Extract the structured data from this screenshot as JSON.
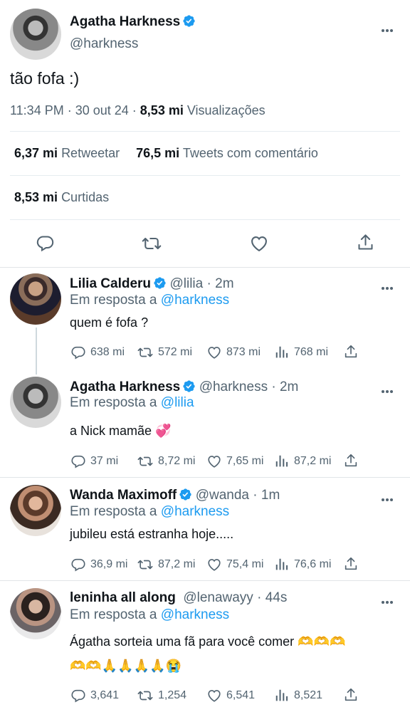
{
  "main_tweet": {
    "name": "Agatha Harkness",
    "handle": "@harkness",
    "text": "tão fofa :)",
    "time": "11:34 PM",
    "date": "30 out 24",
    "views_count": "8,53 mi",
    "views_label": "Visualizações",
    "retweets_count": "6,37 mi",
    "retweets_label": "Retweetar",
    "quotes_count": "76,5 mi",
    "quotes_label": "Tweets com comentário",
    "likes_count": "8,53 mi",
    "likes_label": "Curtidas"
  },
  "reply_prefix": "Em resposta a",
  "replies": [
    {
      "name": "Lilia Calderu",
      "handle": "@lilia",
      "time": "2m",
      "reply_to": "@harkness",
      "text": "quem é fofa ?",
      "replies": "638 mi",
      "retweets": "572 mi",
      "likes": "873 mi",
      "views": "768 mi"
    },
    {
      "name": "Agatha Harkness",
      "handle": "@harkness",
      "time": "2m",
      "reply_to": "@lilia",
      "text": "a Nick mamãe 💞",
      "replies": "37 mi",
      "retweets": "8,72 mi",
      "likes": "7,65 mi",
      "views": "87,2 mi"
    },
    {
      "name": "Wanda Maximoff",
      "handle": "@wanda",
      "time": "1m",
      "reply_to": "@harkness",
      "text": "jubileu está estranha hoje.....",
      "replies": "36,9 mi",
      "retweets": "87,2 mi",
      "likes": "75,4 mi",
      "views": "76,6 mi"
    },
    {
      "name": "leninha all along",
      "handle": "@lenawayy",
      "time": "44s",
      "reply_to": "@harkness",
      "text_line1": "Ágatha sorteia uma fã para você comer 🫶🫶🫶",
      "text_line2": "🫶🫶🙏🙏🙏🙏😭",
      "replies": "3,641",
      "retweets": "1,254",
      "likes": "6,541",
      "views": "8,521"
    }
  ],
  "colors": {
    "accent": "#1d9bf0",
    "secondary_text": "#536471",
    "divider": "#e1e5e8"
  }
}
